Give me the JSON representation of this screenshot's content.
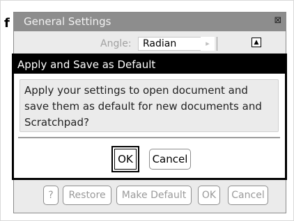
{
  "settings": {
    "title": "General Settings",
    "angle_label": "Angle:",
    "angle_value": "Radian",
    "close_glyph": "⊠",
    "scroll_up_glyph": "▲",
    "background_marker": "f"
  },
  "buttons": {
    "help": "?",
    "restore": "Restore",
    "make_default": "Make Default",
    "ok": "OK",
    "cancel": "Cancel"
  },
  "dialog": {
    "title": "Apply and Save as Default",
    "message": "Apply your settings to open document and save them as default for new documents and Scratchpad?",
    "ok": "OK",
    "cancel": "Cancel"
  },
  "colors": {
    "dialog_title_bg": "#000000",
    "settings_title_bg": "#8d8d8d",
    "panel_bg": "#ebebeb"
  }
}
